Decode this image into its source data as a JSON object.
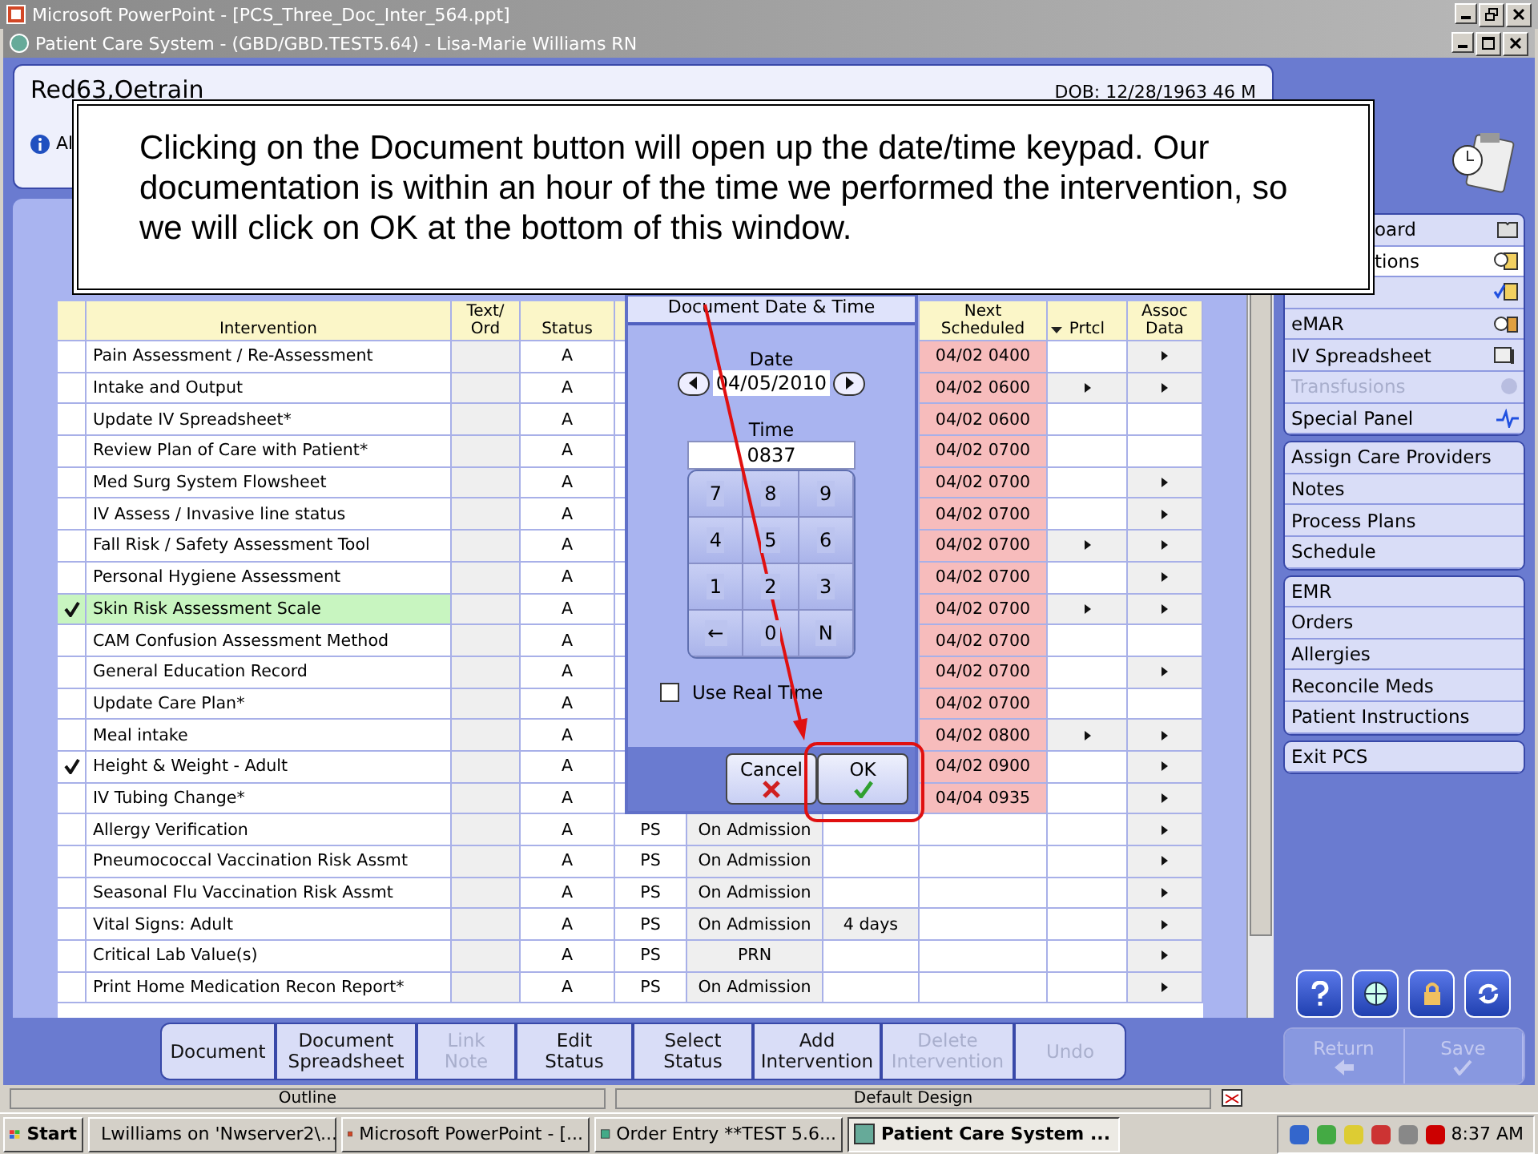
{
  "ppt_window": {
    "title": "Microsoft PowerPoint - [PCS_Three_Doc_Inter_564.ppt]"
  },
  "app_window": {
    "title": "Patient Care System - (GBD/GBD.TEST5.64) - Lisa-Marie Williams RN"
  },
  "patient": {
    "name": "Red63,Oetrain",
    "dob": "DOB: 12/28/1963 46 M",
    "alert": "Al"
  },
  "callout": {
    "text": "Clicking on the Document button will open up the date/time keypad. Our documentation is within an hour of the time we performed the intervention, so we will click on OK at the bottom of this window."
  },
  "table": {
    "columns": [
      {
        "lines": [
          "Intervention"
        ]
      },
      {
        "lines": [
          "Text/",
          "Ord"
        ]
      },
      {
        "lines": [
          "Status"
        ]
      },
      {
        "lines": [
          "Next",
          "Scheduled"
        ]
      },
      {
        "lines": [
          "Prtcl"
        ]
      },
      {
        "lines": [
          "Assoc",
          "Data"
        ]
      }
    ],
    "rows": [
      {
        "checked": false,
        "selected": false,
        "intervention": "Pain Assessment / Re-Assessment",
        "status": "A",
        "next": "04/02 0400",
        "prtcl": false,
        "assoc": true
      },
      {
        "checked": false,
        "selected": false,
        "intervention": "Intake and Output",
        "status": "A",
        "next": "04/02 0600",
        "prtcl": true,
        "assoc": true
      },
      {
        "checked": false,
        "selected": false,
        "intervention": "Update IV Spreadsheet*",
        "status": "A",
        "next": "04/02 0600",
        "prtcl": false,
        "assoc": false
      },
      {
        "checked": false,
        "selected": false,
        "intervention": "Review Plan of Care with Patient*",
        "status": "A",
        "next": "04/02 0700",
        "prtcl": false,
        "assoc": false
      },
      {
        "checked": false,
        "selected": false,
        "intervention": "Med Surg System Flowsheet",
        "status": "A",
        "next": "04/02 0700",
        "prtcl": false,
        "assoc": true
      },
      {
        "checked": false,
        "selected": false,
        "intervention": "IV Assess / Invasive line status",
        "status": "A",
        "next": "04/02 0700",
        "prtcl": false,
        "assoc": true
      },
      {
        "checked": false,
        "selected": false,
        "intervention": "Fall Risk / Safety Assessment Tool",
        "status": "A",
        "next": "04/02 0700",
        "prtcl": true,
        "assoc": true
      },
      {
        "checked": false,
        "selected": false,
        "intervention": "Personal Hygiene Assessment",
        "status": "A",
        "next": "04/02 0700",
        "prtcl": false,
        "assoc": true
      },
      {
        "checked": true,
        "selected": true,
        "intervention": "Skin Risk Assessment Scale",
        "status": "A",
        "next": "04/02 0700",
        "prtcl": true,
        "assoc": true
      },
      {
        "checked": false,
        "selected": false,
        "intervention": "CAM Confusion Assessment Method",
        "status": "A",
        "next": "04/02 0700",
        "prtcl": false,
        "assoc": false
      },
      {
        "checked": false,
        "selected": false,
        "intervention": "General Education Record",
        "status": "A",
        "next": "04/02 0700",
        "prtcl": false,
        "assoc": true
      },
      {
        "checked": false,
        "selected": false,
        "intervention": "Update Care Plan*",
        "status": "A",
        "next": "04/02 0700",
        "prtcl": false,
        "assoc": false
      },
      {
        "checked": false,
        "selected": false,
        "intervention": "Meal intake",
        "status": "A",
        "next": "04/02 0800",
        "prtcl": true,
        "assoc": true
      },
      {
        "checked": true,
        "selected": false,
        "intervention": "Height & Weight - Adult",
        "status": "A",
        "next": "04/02 0900",
        "prtcl": false,
        "assoc": true
      },
      {
        "checked": false,
        "selected": false,
        "intervention": "IV Tubing Change*",
        "status": "A",
        "next": "04/04 0935",
        "prtcl": false,
        "assoc": true
      },
      {
        "checked": false,
        "selected": false,
        "intervention": "Allergy Verification",
        "status": "A",
        "type": "PS",
        "frequency": "On Admission",
        "prtcl": false,
        "assoc": true
      },
      {
        "checked": false,
        "selected": false,
        "intervention": "Pneumococcal Vaccination Risk Assmt",
        "status": "A",
        "type": "PS",
        "frequency": "On Admission",
        "prtcl": false,
        "assoc": true
      },
      {
        "checked": false,
        "selected": false,
        "intervention": "Seasonal Flu Vaccination Risk Assmt",
        "status": "A",
        "type": "PS",
        "frequency": "On Admission",
        "prtcl": false,
        "assoc": true
      },
      {
        "checked": false,
        "selected": false,
        "intervention": "Vital Signs: Adult",
        "status": "A",
        "type": "PS",
        "frequency": "On Admission",
        "duration": "4 days",
        "prtcl": false,
        "assoc": true
      },
      {
        "checked": false,
        "selected": false,
        "intervention": "Critical Lab Value(s)",
        "status": "A",
        "type": "PS",
        "frequency": "PRN",
        "prtcl": false,
        "assoc": true
      },
      {
        "checked": false,
        "selected": false,
        "intervention": "Print Home Medication Recon Report*",
        "status": "A",
        "type": "PS",
        "frequency": "On Admission",
        "prtcl": false,
        "assoc": true
      }
    ]
  },
  "dialog": {
    "title": "Document Date & Time",
    "date_label": "Date",
    "date": "04/05/2010",
    "time_label": "Time",
    "time": "0837",
    "keys": [
      "7",
      "8",
      "9",
      "4",
      "5",
      "6",
      "1",
      "2",
      "3",
      "←",
      "0",
      "N"
    ],
    "real_time": {
      "label": "Use Real Time",
      "checked": false
    },
    "buttons": [
      {
        "label": "Cancel",
        "kind": "cancel"
      },
      {
        "label": "OK",
        "kind": "ok"
      }
    ]
  },
  "sidebar": {
    "groups": [
      {
        "items": [
          {
            "label": "oard",
            "kind": "covered",
            "selected": false,
            "disabled": false
          },
          {
            "label": "tions",
            "kind": "covered",
            "selected": true,
            "disabled": false
          },
          {
            "kind": "covered",
            "selected": false
          },
          {
            "label": "eMAR",
            "kind": "plain",
            "selected": false,
            "disabled": false
          },
          {
            "label": "IV Spreadsheet",
            "kind": "plain",
            "selected": false,
            "disabled": false
          },
          {
            "label": "Transfusions",
            "kind": "plain",
            "selected": false,
            "disabled": true
          },
          {
            "label": "Special Panel",
            "kind": "plain",
            "selected": false,
            "disabled": false
          }
        ]
      },
      {
        "items": [
          {
            "label": "Assign Care Providers",
            "kind": "plain",
            "selected": false,
            "disabled": false
          },
          {
            "label": "Notes",
            "kind": "plain",
            "selected": false,
            "disabled": false
          },
          {
            "label": "Process Plans",
            "kind": "plain",
            "selected": false,
            "disabled": false
          },
          {
            "label": "Schedule",
            "kind": "plain",
            "selected": false,
            "disabled": false
          }
        ]
      },
      {
        "items": [
          {
            "label": "EMR",
            "kind": "plain",
            "selected": false,
            "disabled": false
          },
          {
            "label": "Orders",
            "kind": "plain",
            "selected": false,
            "disabled": false
          },
          {
            "label": "Allergies",
            "kind": "plain",
            "selected": false,
            "disabled": false
          },
          {
            "label": "Reconcile Meds",
            "kind": "plain",
            "selected": false,
            "disabled": false
          },
          {
            "label": "Patient Instructions",
            "kind": "plain",
            "selected": false,
            "disabled": false
          }
        ]
      },
      {
        "items": [
          {
            "label": "Exit PCS",
            "kind": "plain",
            "selected": false,
            "disabled": false
          }
        ]
      }
    ]
  },
  "toolbar": [
    {
      "lines": [
        "Document"
      ],
      "disabled": false
    },
    {
      "lines": [
        "Document",
        "Spreadsheet"
      ],
      "disabled": false
    },
    {
      "lines": [
        "Link",
        "Note"
      ],
      "disabled": true
    },
    {
      "lines": [
        "Edit",
        "Status"
      ],
      "disabled": false
    },
    {
      "lines": [
        "Select",
        "Status"
      ],
      "disabled": false
    },
    {
      "lines": [
        "Add",
        "Intervention"
      ],
      "disabled": false
    },
    {
      "lines": [
        "Delete",
        "Intervention"
      ],
      "disabled": true
    },
    {
      "lines": [
        "Undo"
      ],
      "disabled": true
    }
  ],
  "nav_buttons": [
    {
      "label": "Return",
      "kind": "return",
      "disabled": true
    },
    {
      "label": "Save",
      "kind": "save",
      "disabled": true
    }
  ],
  "status_bar": [
    "Outline",
    "Default Design"
  ],
  "taskbar": {
    "start": "Start",
    "tasks": [
      {
        "label": "Lwilliams on 'Nwserver2\\...",
        "selected": false
      },
      {
        "label": "Microsoft PowerPoint - [...",
        "selected": false
      },
      {
        "label": "Order Entry **TEST 5.6...",
        "selected": false
      },
      {
        "label": "Patient Care System ...",
        "selected": true
      }
    ],
    "clock": "8:37 AM"
  }
}
